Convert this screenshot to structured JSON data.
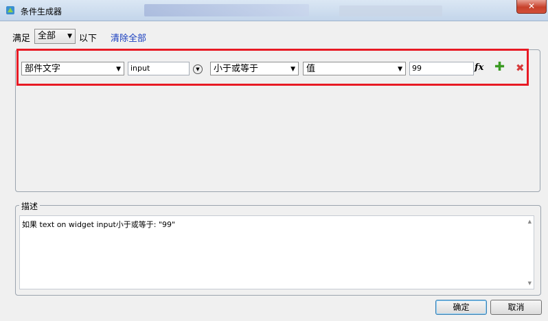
{
  "window": {
    "title": "条件生成器",
    "close_label": "✕"
  },
  "top": {
    "prefix": "满足",
    "match_select": "全部",
    "suffix": "以下",
    "clear_all": "清除全部"
  },
  "condition": {
    "field_select": "部件文字",
    "widget_input": "input",
    "operator_select": "小于或等于",
    "type_select": "值",
    "value_input": "99"
  },
  "description": {
    "legend": "描述",
    "text": "如果 text on widget input小于或等于: \"99\""
  },
  "buttons": {
    "ok": "确定",
    "cancel": "取消"
  },
  "icons": {
    "app": "app-icon",
    "fx": "function-icon",
    "add": "plus-icon",
    "remove": "cross-icon",
    "dropdown": "chevron-down-icon"
  },
  "colors": {
    "highlight": "#e81a24",
    "link": "#1a3fbf",
    "add": "#3a9a22",
    "remove": "#d63a3a"
  }
}
